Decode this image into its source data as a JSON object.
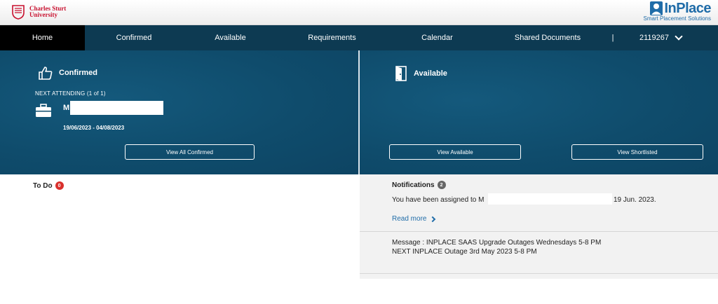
{
  "header": {
    "university_line1": "Charles Sturt",
    "university_line2": "University",
    "brand_name": "InPlace",
    "brand_tagline": "Smart Placement Solutions"
  },
  "nav": {
    "home": "Home",
    "confirmed": "Confirmed",
    "available": "Available",
    "requirements": "Requirements",
    "calendar": "Calendar",
    "shared_documents": "Shared Documents",
    "separator": "|",
    "user_id": "2119267"
  },
  "confirmed_panel": {
    "title": "Confirmed",
    "next_attending": "NEXT ATTENDING (1 of 1)",
    "placement_initial": "M",
    "dates": "19/06/2023 - 04/08/2023",
    "view_all_button": "View All Confirmed"
  },
  "available_panel": {
    "title": "Available",
    "view_available_button": "View Available",
    "view_shortlisted_button": "View Shortlisted"
  },
  "todo": {
    "title": "To Do",
    "count": "0"
  },
  "notifications": {
    "title": "Notifications",
    "count": "2",
    "assigned_text": "You have been assigned to M",
    "assigned_date": "19 Jun. 2023.",
    "read_more": "Read more",
    "message_line1": "Message : INPLACE SAAS Upgrade Outages Wednesdays 5-8 PM",
    "message_line2": "NEXT INPLACE Outage 3rd May 2023 5-8 PM"
  },
  "colors": {
    "nav_bg": "#0d3a52",
    "hero_bg": "#0f4c6c",
    "brand_blue": "#1f6ca8",
    "csu_red": "#c8102e",
    "badge_red": "#d9302c"
  },
  "icons": {
    "confirmed": "thumbs-up-icon",
    "available": "open-door-icon",
    "placement": "briefcase-icon",
    "user_menu": "chevron-down-icon",
    "read_more": "chevron-right-icon"
  }
}
